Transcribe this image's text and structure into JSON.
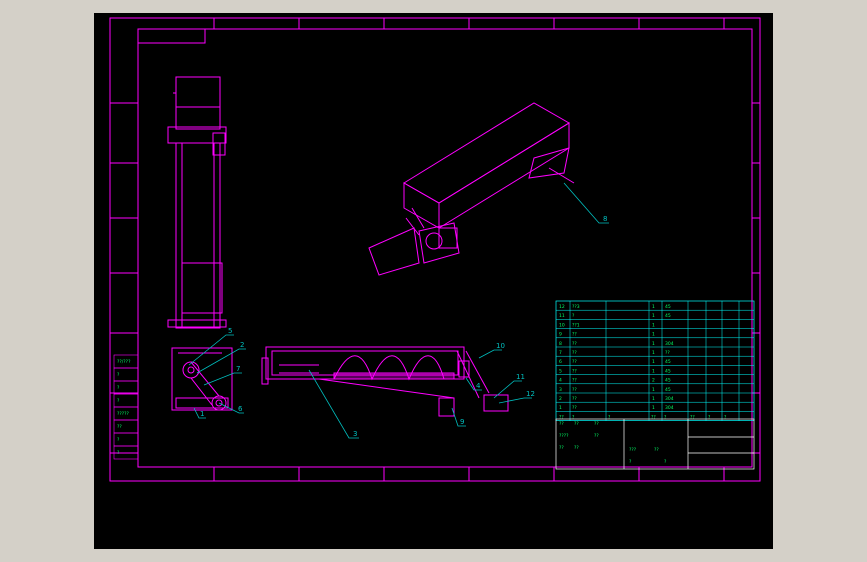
{
  "colors": {
    "background": "#000000",
    "frame": "#ff00ff",
    "leader": "#00c0c0",
    "table_text": "#00ff66",
    "table_lines": "#00ffff",
    "part_text": "#ff66ff",
    "title_lines": "#ffffff"
  },
  "balloons": [
    "8",
    "5",
    "2",
    "7",
    "6",
    "1",
    "3",
    "4",
    "9",
    "10",
    "11",
    "12"
  ],
  "bom_rows": [
    {
      "no": "12",
      "code": "??3",
      "qty": "1",
      "mat": "45"
    },
    {
      "no": "11",
      "code": "?",
      "qty": "1",
      "mat": "45"
    },
    {
      "no": "10",
      "code": "??1",
      "qty": "1",
      "mat": ""
    },
    {
      "no": "9",
      "code": "??",
      "qty": "1",
      "mat": ""
    },
    {
      "no": "8",
      "code": "??",
      "qty": "1",
      "mat": "304"
    },
    {
      "no": "7",
      "code": "??",
      "qty": "1",
      "mat": "??"
    },
    {
      "no": "6",
      "code": "??",
      "qty": "1",
      "mat": "45"
    },
    {
      "no": "5",
      "code": "??",
      "qty": "1",
      "mat": "45"
    },
    {
      "no": "4",
      "code": "??",
      "qty": "2",
      "mat": "45"
    },
    {
      "no": "3",
      "code": "??",
      "qty": "1",
      "mat": "45"
    },
    {
      "no": "2",
      "code": "??",
      "qty": "1",
      "mat": "304"
    },
    {
      "no": "1",
      "code": "??",
      "qty": "1",
      "mat": "304"
    }
  ],
  "bom_header": [
    "??",
    "?",
    "?",
    "??",
    "?",
    "??",
    "?",
    "?"
  ],
  "side_table": [
    "??/???",
    "?",
    "?",
    "?",
    "?????",
    "??",
    "?",
    "?"
  ],
  "title_block": {
    "cells": [
      "??",
      "??",
      "??",
      "????",
      "??",
      "??",
      "??",
      "???",
      "??",
      "?",
      "?"
    ]
  }
}
